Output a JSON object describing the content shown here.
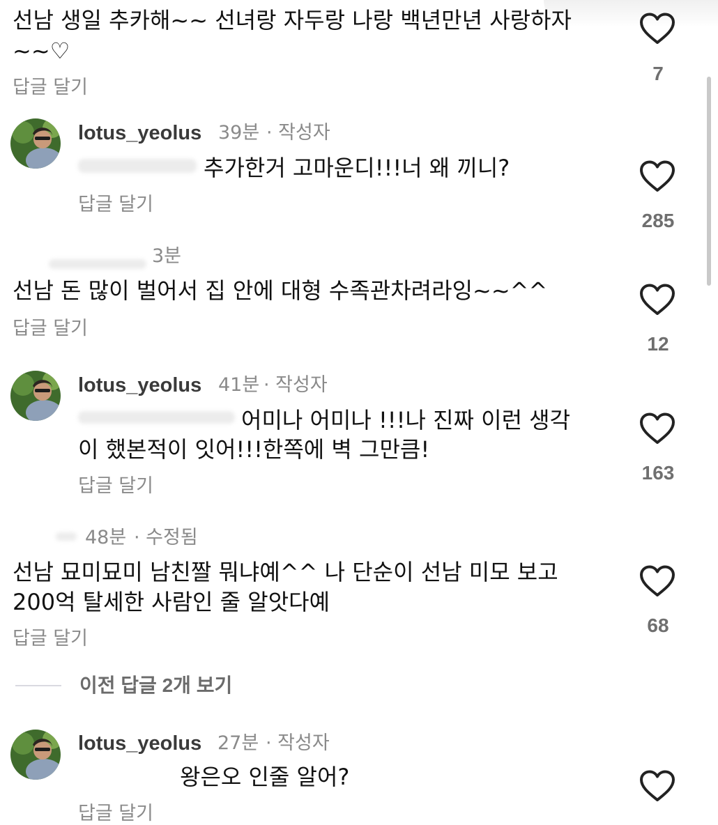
{
  "comments": [
    {
      "text_line1": "선남 생일 추카해~~ 선녀랑 자두랑 나랑 백년만년 사랑하자",
      "text_line2": "~~♡",
      "reply": "답글 달기",
      "likes": "7"
    },
    {
      "username": "lotus_yeolus",
      "time": "39분",
      "badge": "· 작성자",
      "text_line1": "추가한거 고마운디!!!너 왜 끼니?",
      "reply": "답글 달기",
      "likes": "285"
    },
    {
      "time": "3분",
      "text_line1": "선남 돈 많이 벌어서 집 안에 대형 수족관차려라잉~~^^",
      "reply": "답글 달기",
      "likes": "12"
    },
    {
      "username": "lotus_yeolus",
      "time": "41분",
      "badge": "· 작성자",
      "text_line1": "어미나 어미나 !!!나 진짜 이런 생각",
      "text_line2": "이 했본적이 잇어!!!한쪽에 벽 그만큼!",
      "reply": "답글 달기",
      "likes": "163"
    },
    {
      "time": "48분",
      "badge": "· 수정됨",
      "text_line1": "선남 묘미묘미 남친짤 뭐냐예^^ 나 단순이 선남 미모 보고",
      "text_line2": "200억 탈세한 사람인 줄 알앗다예",
      "reply": "답글 달기",
      "likes": "68"
    },
    {
      "username": "lotus_yeolus",
      "time": "27분",
      "badge": "· 작성자",
      "text_line1": "왕은오 인줄 알어?",
      "reply": "답글 달기",
      "likes": ""
    }
  ],
  "view_previous": "이전 답글 2개 보기",
  "icons": {
    "like": "heart-outline-icon"
  },
  "colors": {
    "text": "#111111",
    "secondary": "#8a8a8a",
    "username": "#3a3a3a"
  }
}
